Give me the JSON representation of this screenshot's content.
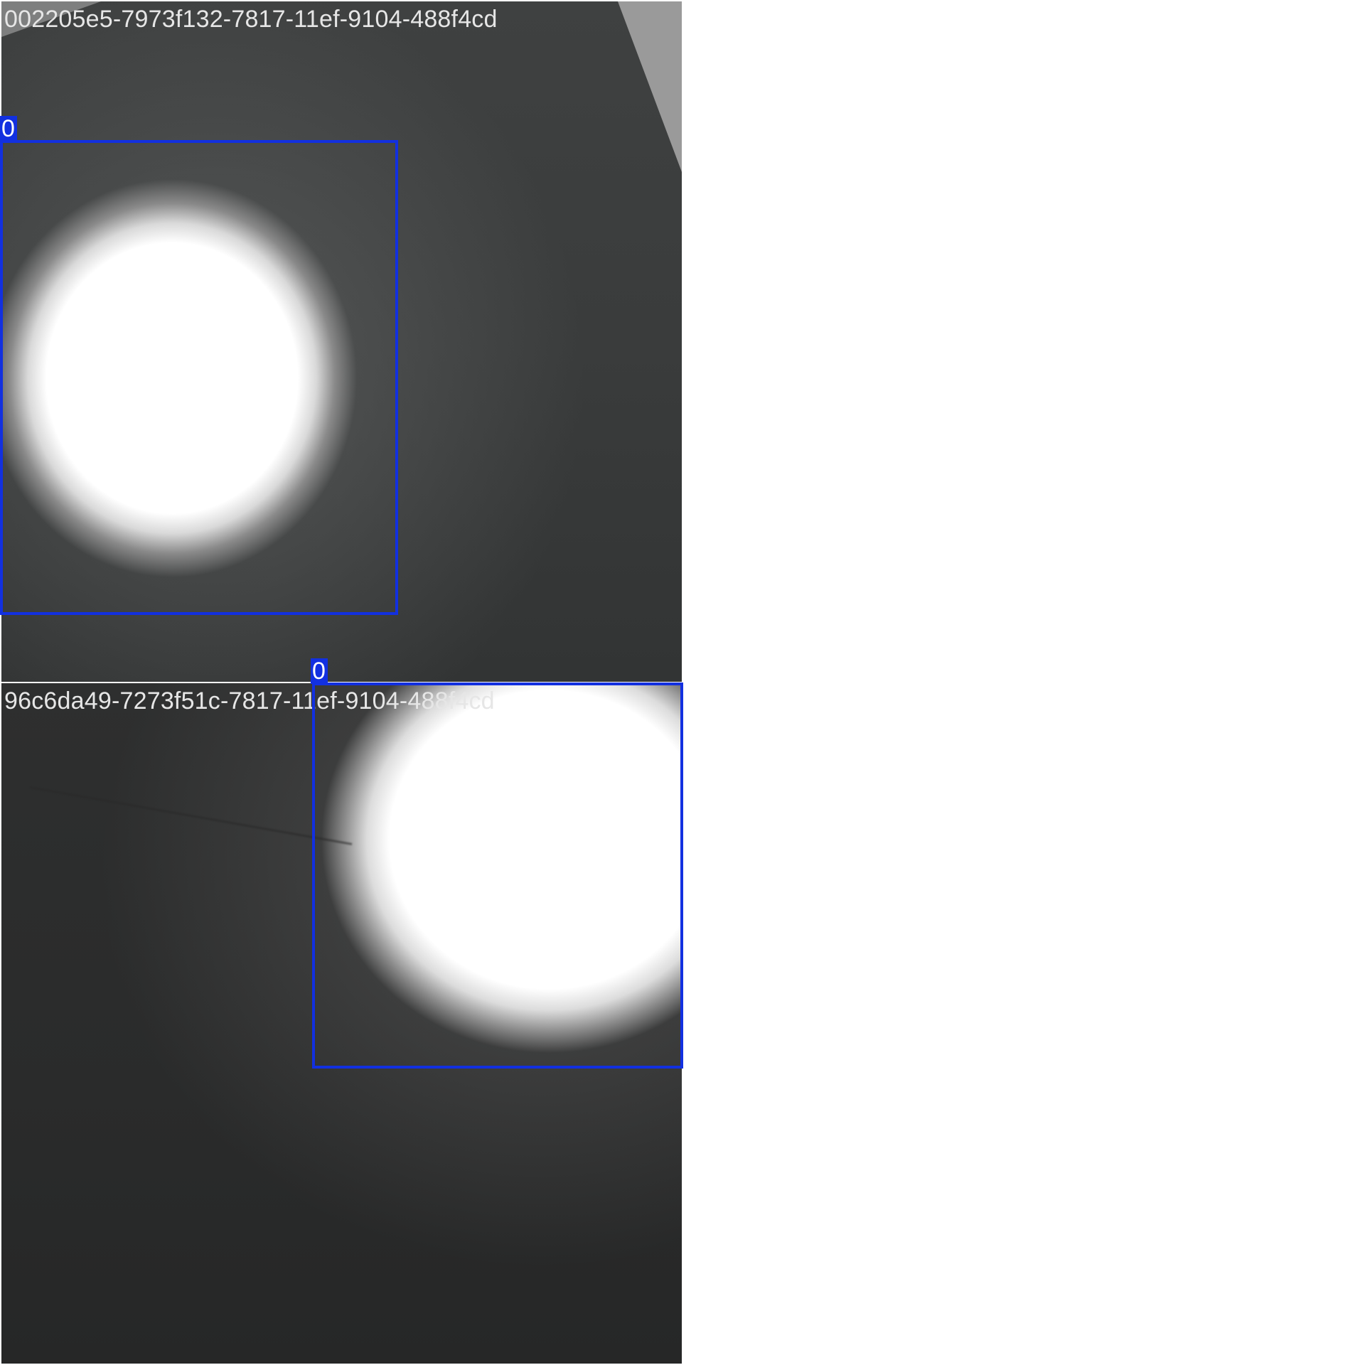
{
  "tiles": [
    {
      "title": "002205e5-7973f132-7817-11ef-9104-488f4cd",
      "detections": [
        {
          "label": "0"
        }
      ]
    },
    {
      "title": "96c6da49-7273f51c-7817-11ef-9104-488f4cd",
      "detections": [
        {
          "label": "0"
        }
      ]
    }
  ],
  "colors": {
    "bbox": "#1230e0",
    "background": "#ffffff",
    "title_text": "#e6e6e6"
  }
}
